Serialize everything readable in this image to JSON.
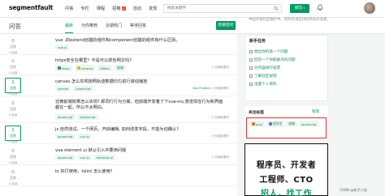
{
  "nav": {
    "logo": "segmentfault",
    "items": [
      "问答",
      "专栏",
      "课程",
      "招聘",
      "活动",
      "发现"
    ],
    "notification_badge": "6",
    "search_placeholder": "搜索关键字",
    "write_label": "撰写",
    "bell_count": ""
  },
  "subheader": {
    "title": "问答",
    "tabs": [
      "最新",
      "为你推荐",
      "近期热门",
      "等待回答"
    ],
    "active_tab": 0,
    "ask_label": "我要提问"
  },
  "questions": [
    {
      "answers": "0",
      "answers_label": "回答",
      "views": "0 阅读",
      "title": "vue .的extend创建的组件和component创建的组件有什么区别。",
      "tags": [
        {
          "name": "vue.js",
          "icon": ""
        }
      ],
      "meta": "",
      "answered": false
    },
    {
      "answers": "0",
      "answers_label": "回答",
      "views": "0 阅读",
      "title": "https安全在哪里？不是可以抓包明文吗?",
      "tags": [
        {
          "name": "https",
          "icon": "lock"
        },
        {
          "name": "chrome",
          "icon": "chrome"
        },
        {
          "name": "fiddler",
          "icon": ""
        },
        {
          "name": "前端",
          "icon": ""
        }
      ],
      "meta": "",
      "answered": false
    },
    {
      "answers": "1",
      "answers_label": "回答",
      "views": "4 阅读",
      "title": "canvas 怎么实现按照轨迹数据均匀进行滚动播放",
      "tags": [
        {
          "name": "canvas",
          "icon": ""
        },
        {
          "name": "javascript",
          "icon": ""
        }
      ],
      "meta": "",
      "answered": true
    },
    {
      "answers": "0",
      "answers_label": "回答",
      "views": "4 阅读",
      "title": "迈微前端效果怎么实现? 即同行行为分离，但前端开发看了下vue+ts,感觉现在行为和界面都在一起，所以不太明白。",
      "tags": [
        {
          "name": "javascript",
          "icon": ""
        },
        {
          "name": "typescript",
          "icon": ""
        }
      ],
      "meta": "",
      "answered": false
    },
    {
      "answers": "1",
      "answers_label": "回答",
      "views": "4 阅读",
      "title": "js 自然测试，一个网页，开启编辑, 如何改变字段，不能为动确认?",
      "tags": [
        {
          "name": "javascript",
          "icon": ""
        },
        {
          "name": "vue.js",
          "icon": ""
        }
      ],
      "meta": "fdfan",
      "answered": true
    },
    {
      "answers": "0",
      "answers_label": "回答",
      "views": "4 阅读",
      "title": "vue element ui 默认引入中要用问题",
      "tags": [
        {
          "name": "javascript",
          "icon": ""
        },
        {
          "name": "vue.js",
          "icon": ""
        },
        {
          "name": "element-ui",
          "icon": ""
        }
      ],
      "meta": "",
      "answered": false
    },
    {
      "answers": "0",
      "answers_label": "回答",
      "views": "4 阅读",
      "title": "ts 好打使用，tslint 怎么使用?",
      "tags": [],
      "meta": "",
      "answered": false
    }
  ],
  "metas": [
    {
      "user": "",
      "time": ""
    },
    {
      "user": "",
      "time": "1 分钟前提问"
    },
    {
      "user": "DanTheBird",
      "time": "1 分钟前提问"
    },
    {
      "user": "",
      "time": "1 分钟前提问"
    },
    {
      "user": "",
      "time": "1 分钟前提问"
    },
    {
      "user": "",
      "time": "1 分钟前提问"
    },
    {
      "user": "",
      "time": ""
    }
  ],
  "sidebar": {
    "hint": "中国开源社区维护中，得到开源支持的所有开发者。",
    "tasks_title": "新手任务",
    "tasks": [
      "想出你的第一个问题",
      "回答一个你能解决的问题",
      "对内容进行投票",
      "了解社区规则",
      "设置个人资料"
    ],
    "follow_title": "关注标签",
    "follow_manage": "管理",
    "follow_tags": [
      "java",
      "程序员",
      "前端",
      "javascript"
    ],
    "ad_lines": [
      "程序员、开发者",
      "工程师、CTO",
      "招人，找工作"
    ]
  },
  "watermark": "CSDN @轮子二宏",
  "colors": {
    "accent": "#019a61",
    "highlight_box": "#e02e2e"
  }
}
